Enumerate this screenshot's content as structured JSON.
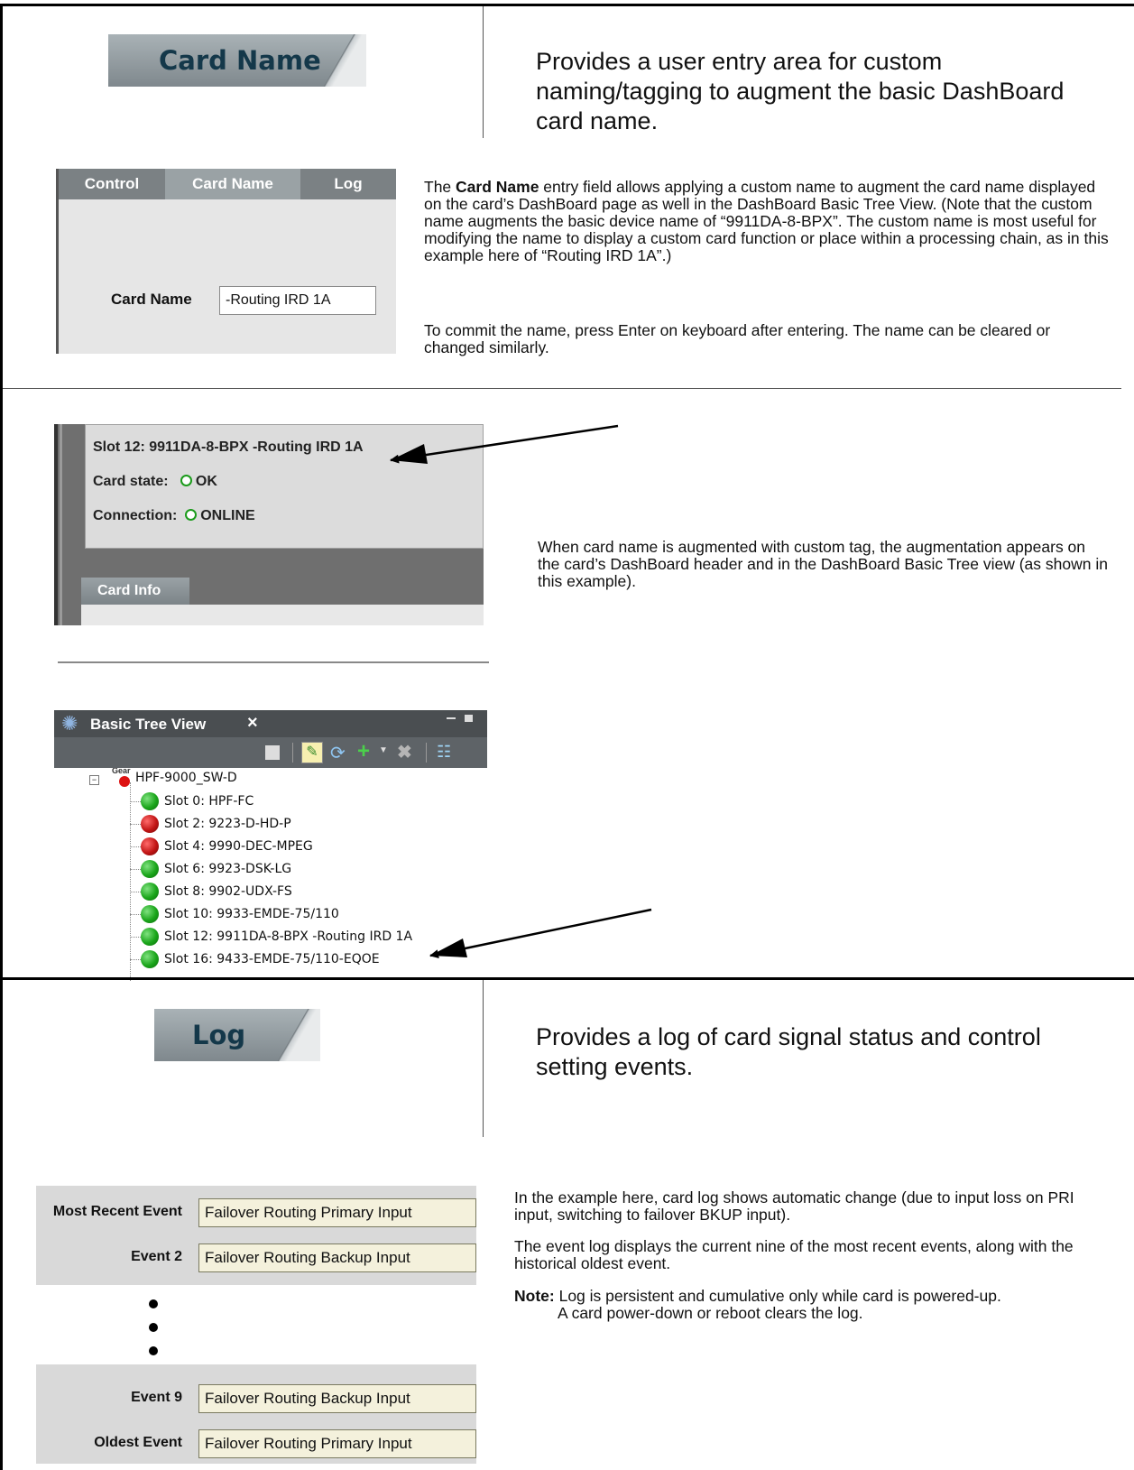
{
  "card_name_section": {
    "tab_label": "Card Name",
    "description": "Provides a user entry area for custom naming/tagging to augment the basic DashBoard card name."
  },
  "card_name_panel": {
    "tabs": [
      "Control",
      "Card Name",
      "Log"
    ],
    "field_label": "Card Name",
    "field_value": "-Routing IRD 1A"
  },
  "card_name_text": {
    "p1_lead": "The ",
    "p1_bold": "Card Name",
    "p1_rest": " entry field allows applying a custom name to augment the card name displayed on the card’s DashBoard page as well in the DashBoard Basic Tree View. (Note that the custom name augments the basic device name of “9911DA-8-BPX”. The custom name is most useful for modifying the name to display a custom card function or place within a processing chain, as in this example here of “Routing IRD 1A”.)",
    "p2": "To commit the name, press Enter on keyboard after entering. The name can be cleared or changed similarly."
  },
  "header_panel": {
    "slot_title": "Slot 12: 9911DA-8-BPX -Routing IRD 1A",
    "card_state_label": "Card state:",
    "card_state_value": "OK",
    "connection_label": "Connection:",
    "connection_value": "ONLINE",
    "tab_label": "Card Info"
  },
  "augment_text": "When card name is augmented with custom tag, the augmentation appears on the card’s DashBoard header and in the DashBoard Basic Tree view (as shown in this example).",
  "tree_view": {
    "title": "Basic Tree View",
    "close": "×",
    "root_icon_text": "Gear",
    "root": "HPF-9000_SW-D",
    "items": [
      {
        "label": "Slot 0: HPF-FC",
        "status": "green"
      },
      {
        "label": "Slot 2: 9223-D-HD-P",
        "status": "red"
      },
      {
        "label": "Slot 4: 9990-DEC-MPEG",
        "status": "red"
      },
      {
        "label": "Slot 6: 9923-DSK-LG",
        "status": "green"
      },
      {
        "label": "Slot 8: 9902-UDX-FS",
        "status": "green"
      },
      {
        "label": "Slot 10: 9933-EMDE-75/110",
        "status": "green"
      },
      {
        "label": "Slot 12: 9911DA-8-BPX -Routing IRD 1A",
        "status": "green"
      },
      {
        "label": "Slot 16: 9433-EMDE-75/110-EQOE",
        "status": "green"
      }
    ]
  },
  "log_section": {
    "tab_label": "Log",
    "description": "Provides a log of card signal status and control setting events."
  },
  "log_fields": {
    "most_recent_label": "Most Recent Event",
    "most_recent_value": "Failover Routing Primary Input",
    "event2_label": "Event 2",
    "event2_value": "Failover Routing Backup Input",
    "event9_label": "Event 9",
    "event9_value": "Failover Routing Backup Input",
    "oldest_label": "Oldest Event",
    "oldest_value": "Failover Routing Primary Input"
  },
  "log_text": {
    "p1": "In the example here, card log shows automatic change (due to input loss on PRI input, switching to failover BKUP input).",
    "p2": "The event log displays the current nine of the most recent events, along with the historical oldest event.",
    "note_label": "Note:",
    "note_line1": " Log is persistent and cumulative only while card is powered-up.",
    "note_line2": "A card power-down or reboot clears the log."
  }
}
